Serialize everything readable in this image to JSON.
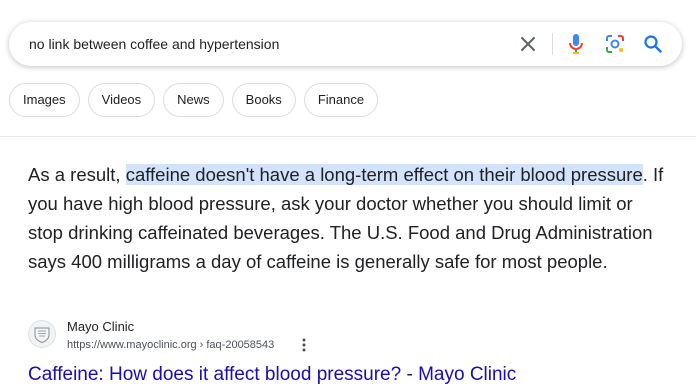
{
  "search": {
    "query": "no link between coffee and hypertension",
    "icons": [
      "close-icon",
      "mic-icon",
      "lens-icon",
      "search-icon"
    ]
  },
  "chips": [
    "Images",
    "Videos",
    "News",
    "Books",
    "Finance"
  ],
  "snippet": {
    "before": "As a result, ",
    "highlight": "caffeine doesn't have a long-term effect on their blood pressure",
    "after": ". If you have high blood pressure, ask your doctor whether you should limit or stop drinking caffeinated beverages. The U.S. Food and Drug Administration says 400 milligrams a day of caffeine is generally safe for most people."
  },
  "result": {
    "favicon_text": "MAYO CLINIC",
    "site_name": "Mayo Clinic",
    "url": "https://www.mayoclinic.org › faq-20058543",
    "title": "Caffeine: How does it affect blood pressure? - Mayo Clinic"
  },
  "colors": {
    "link": "#1a0dab",
    "highlight": "#d3e3fd",
    "search_blue": "#1a73e8"
  }
}
